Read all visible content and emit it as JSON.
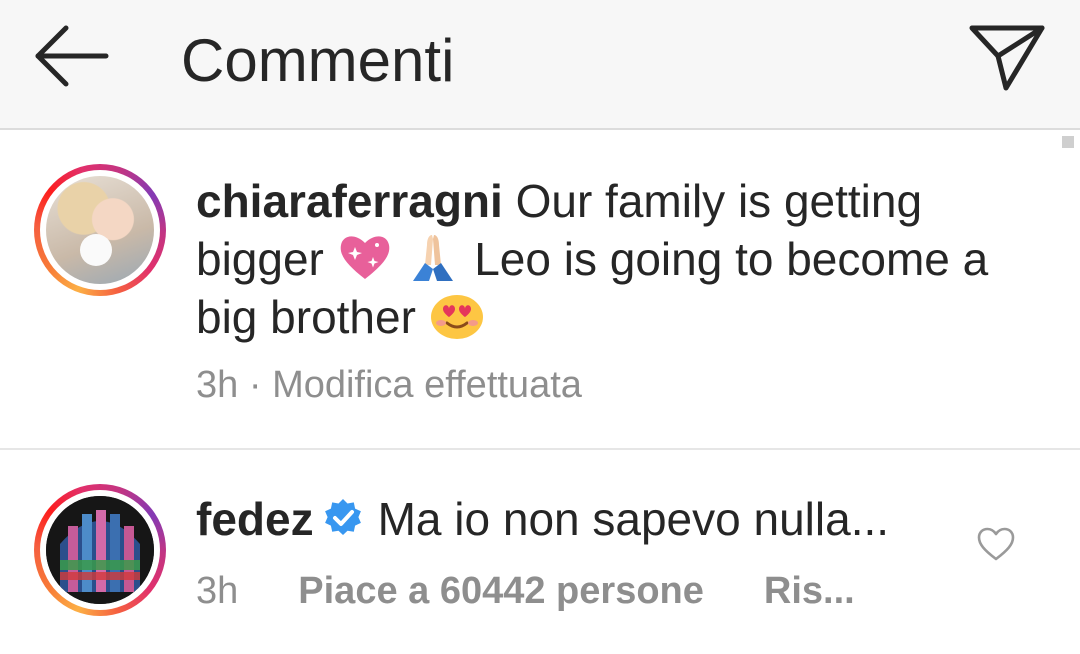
{
  "header": {
    "title": "Commenti",
    "back_icon": "arrow-left-icon",
    "send_icon": "paper-plane-icon",
    "background": "#f7f7f7"
  },
  "caption": {
    "username": "chiaraferragni",
    "text_part1": "Our family is getting bigger",
    "emoji_1": "sparkling-heart-emoji",
    "emoji_2": "folded-hands-emoji",
    "text_part2": "Leo is going to become a big brother",
    "emoji_3": "heart-eyes-emoji",
    "time": "3h",
    "separator": "·",
    "edited_label": "Modifica effettuata"
  },
  "comments": [
    {
      "username": "fedez",
      "verified": true,
      "text": "Ma io non sapevo nulla...",
      "time": "3h",
      "likes": "Piace a 60442 persone",
      "reply": "Ris..."
    }
  ],
  "colors": {
    "text": "#262626",
    "meta": "#8e8e8e",
    "verified": "#3897f0"
  }
}
